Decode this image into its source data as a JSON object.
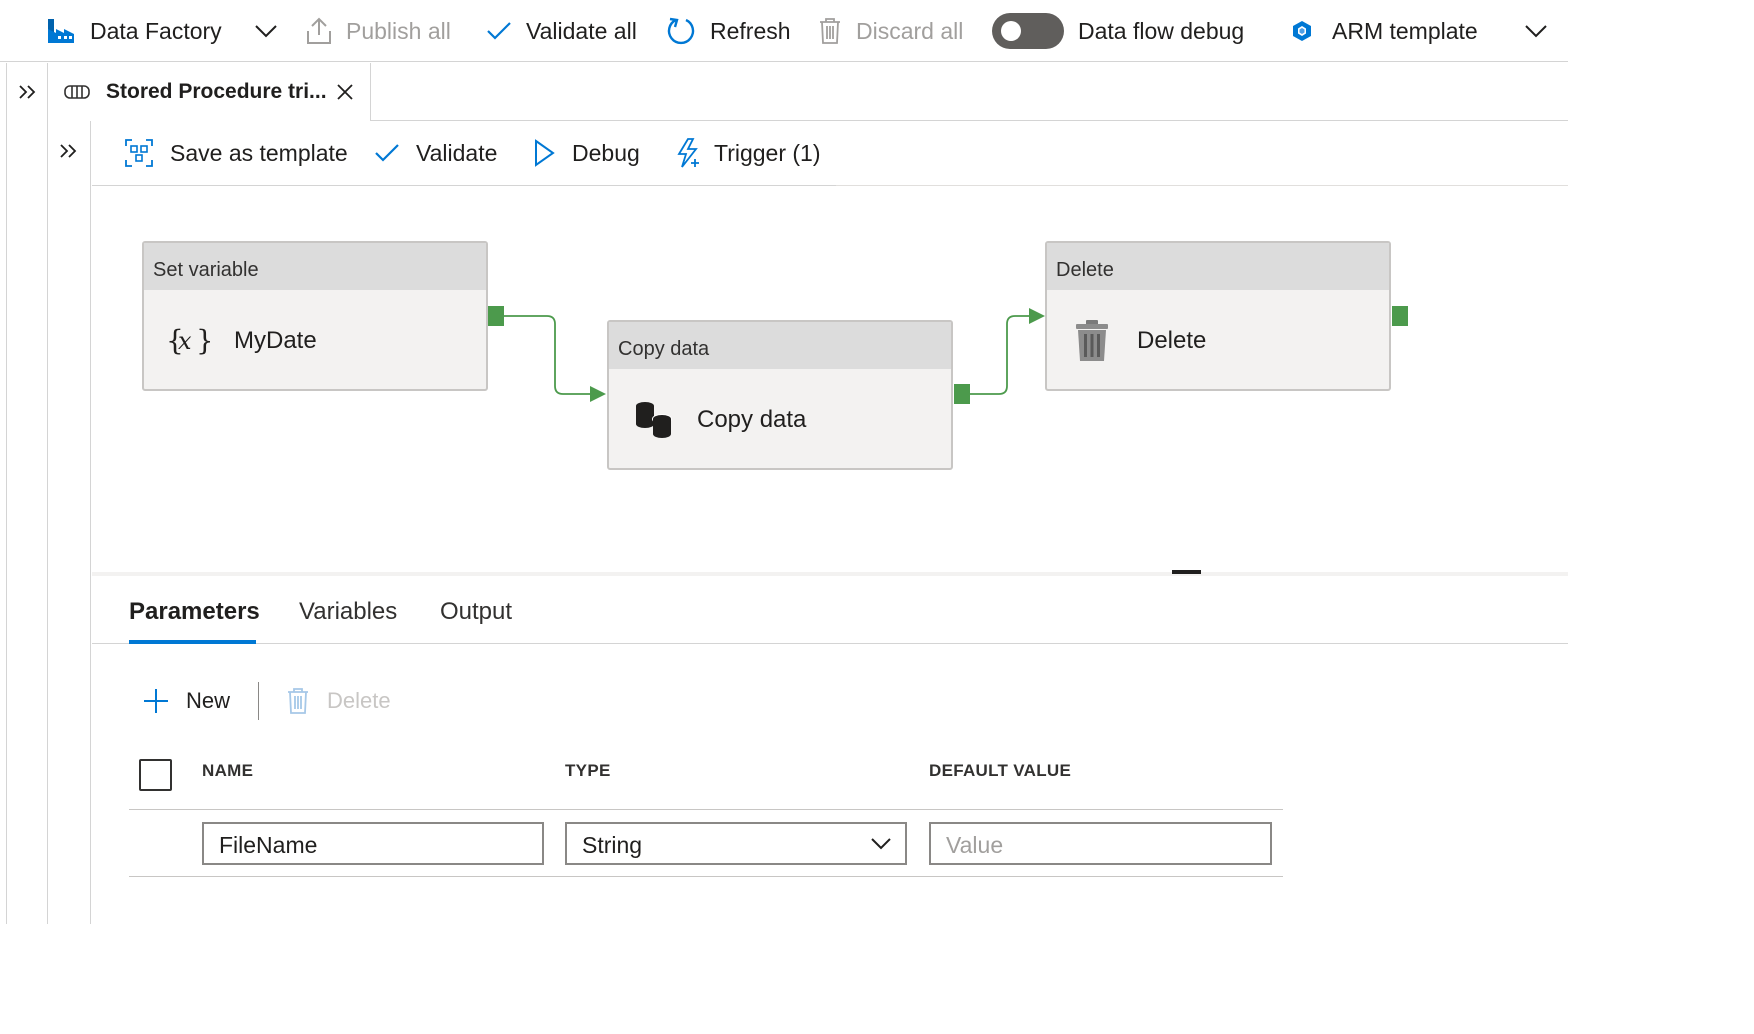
{
  "topbar": {
    "factory_label": "Data Factory",
    "publish_label": "Publish all",
    "validate_all_label": "Validate all",
    "refresh_label": "Refresh",
    "discard_label": "Discard all",
    "dataflow_debug_label": "Data flow debug",
    "dataflow_debug_on": false,
    "arm_label": "ARM template"
  },
  "tab": {
    "title": "Stored Procedure tri..."
  },
  "pipeline_toolbar": {
    "save_template_label": "Save as template",
    "validate_label": "Validate",
    "debug_label": "Debug",
    "trigger_label": "Trigger (1)"
  },
  "activities": [
    {
      "type": "Set variable",
      "name": "MyDate",
      "icon": "variable-icon"
    },
    {
      "type": "Copy data",
      "name": "Copy data",
      "icon": "copy-data-icon"
    },
    {
      "type": "Delete",
      "name": "Delete",
      "icon": "trash-icon"
    }
  ],
  "bottom_tabs": [
    "Parameters",
    "Variables",
    "Output"
  ],
  "bottom_active_tab": "Parameters",
  "commands": {
    "new_label": "New",
    "delete_label": "Delete"
  },
  "grid": {
    "headers": [
      "NAME",
      "TYPE",
      "DEFAULT VALUE"
    ],
    "rows": [
      {
        "name": "FileName",
        "type": "String",
        "default_placeholder": "Value"
      }
    ]
  },
  "colors": {
    "accent": "#0078d4",
    "success_port": "#4c9a4c",
    "disabled_text": "#a19f9d"
  }
}
